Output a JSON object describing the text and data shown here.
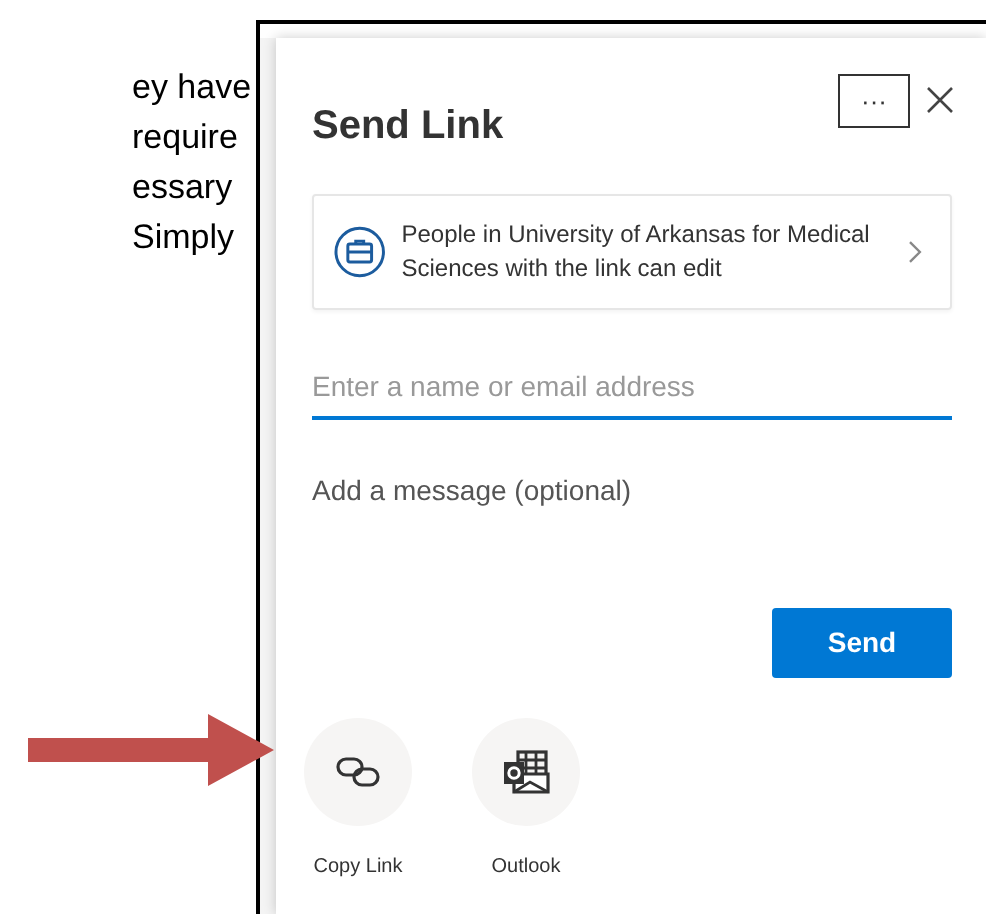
{
  "slide_text": [
    "ey have",
    "require",
    "essary",
    "Simply"
  ],
  "dialog": {
    "title": "Send Link",
    "more_button": "···",
    "permission": "People in University of Arkansas for Medical Sciences with the link can edit",
    "recipient_field": {
      "placeholder": "Enter a name or email address"
    },
    "message_field": {
      "placeholder": "Add a message (optional)"
    },
    "send_button": "Send",
    "share_options": [
      {
        "kind": "copy-link",
        "label": "Copy Link"
      },
      {
        "kind": "outlook",
        "label": "Outlook"
      }
    ]
  }
}
